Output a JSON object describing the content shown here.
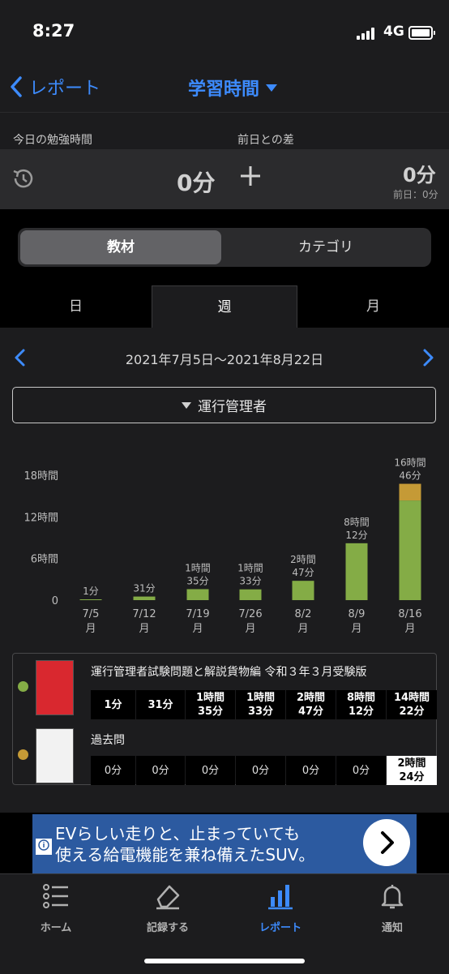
{
  "status_bar": {
    "time": "8:27",
    "network": "4G"
  },
  "nav": {
    "back_label": "レポート",
    "title": "学習時間"
  },
  "summary": {
    "today_label": "今日の勉強時間",
    "diff_label": "前日との差",
    "today_value": "0分",
    "diff_value": "0分",
    "diff_sub": "前日：0分"
  },
  "segment": {
    "materials": "教材",
    "category": "カテゴリ"
  },
  "period_tabs": {
    "day": "日",
    "week": "週",
    "month": "月"
  },
  "date_range": "2021年7月5日〜2021年8月22日",
  "filter_label": "運行管理者",
  "colors": {
    "accent": "#3d8bfd",
    "series1": "#84ac46",
    "series2": "#c59a36"
  },
  "chart_data": {
    "type": "bar",
    "stacked": true,
    "categories": [
      "7/5\n月",
      "7/12\n月",
      "7/19\n月",
      "7/26\n月",
      "8/2\n月",
      "8/9\n月",
      "8/16\n月"
    ],
    "category_dates": [
      "7/5",
      "7/12",
      "7/19",
      "7/26",
      "8/2",
      "8/9",
      "8/16"
    ],
    "category_days": [
      "月",
      "月",
      "月",
      "月",
      "月",
      "月",
      "月"
    ],
    "series": [
      {
        "values": [
          0.0167,
          0.5167,
          1.5833,
          1.55,
          2.7833,
          8.2,
          14.3667
        ],
        "color": "#84ac46"
      },
      {
        "values": [
          0,
          0,
          0,
          0,
          0,
          0,
          2.4
        ],
        "color": "#c59a36"
      }
    ],
    "data_labels": [
      [
        "1分"
      ],
      [
        "31分"
      ],
      [
        "1時間",
        "35分"
      ],
      [
        "1時間",
        "33分"
      ],
      [
        "2時間",
        "47分"
      ],
      [
        "8時間",
        "12分"
      ],
      [
        "16時間",
        "46分"
      ]
    ],
    "yticks": [
      "0",
      "6時間",
      "12時間",
      "18時間"
    ],
    "ytick_values": [
      0,
      6,
      12,
      18
    ],
    "ylim": [
      0,
      18
    ],
    "grid": false
  },
  "table": {
    "books": [
      {
        "name": "運行管理者試験問題と解説貨物編 令和３年３月受験版",
        "dot": "#84ac46",
        "cells": [
          [
            "1分"
          ],
          [
            "31分"
          ],
          [
            "1時間",
            "35分"
          ],
          [
            "1時間",
            "33分"
          ],
          [
            "2時間",
            "47分"
          ],
          [
            "8時間",
            "12分"
          ],
          [
            "14時間",
            "22分"
          ]
        ]
      },
      {
        "name": "過去問",
        "dot": "#c59a36",
        "cells": [
          [
            "0分"
          ],
          [
            "0分"
          ],
          [
            "0分"
          ],
          [
            "0分"
          ],
          [
            "0分"
          ],
          [
            "0分"
          ],
          [
            "2時間",
            "24分"
          ]
        ]
      }
    ]
  },
  "ad": {
    "line1": "EVらしい走りと、止まっていても",
    "line2": "使える給電機能を兼ね備えたSUV。"
  },
  "tabbar": {
    "home": "ホーム",
    "record": "記録する",
    "report": "レポート",
    "notify": "通知"
  }
}
